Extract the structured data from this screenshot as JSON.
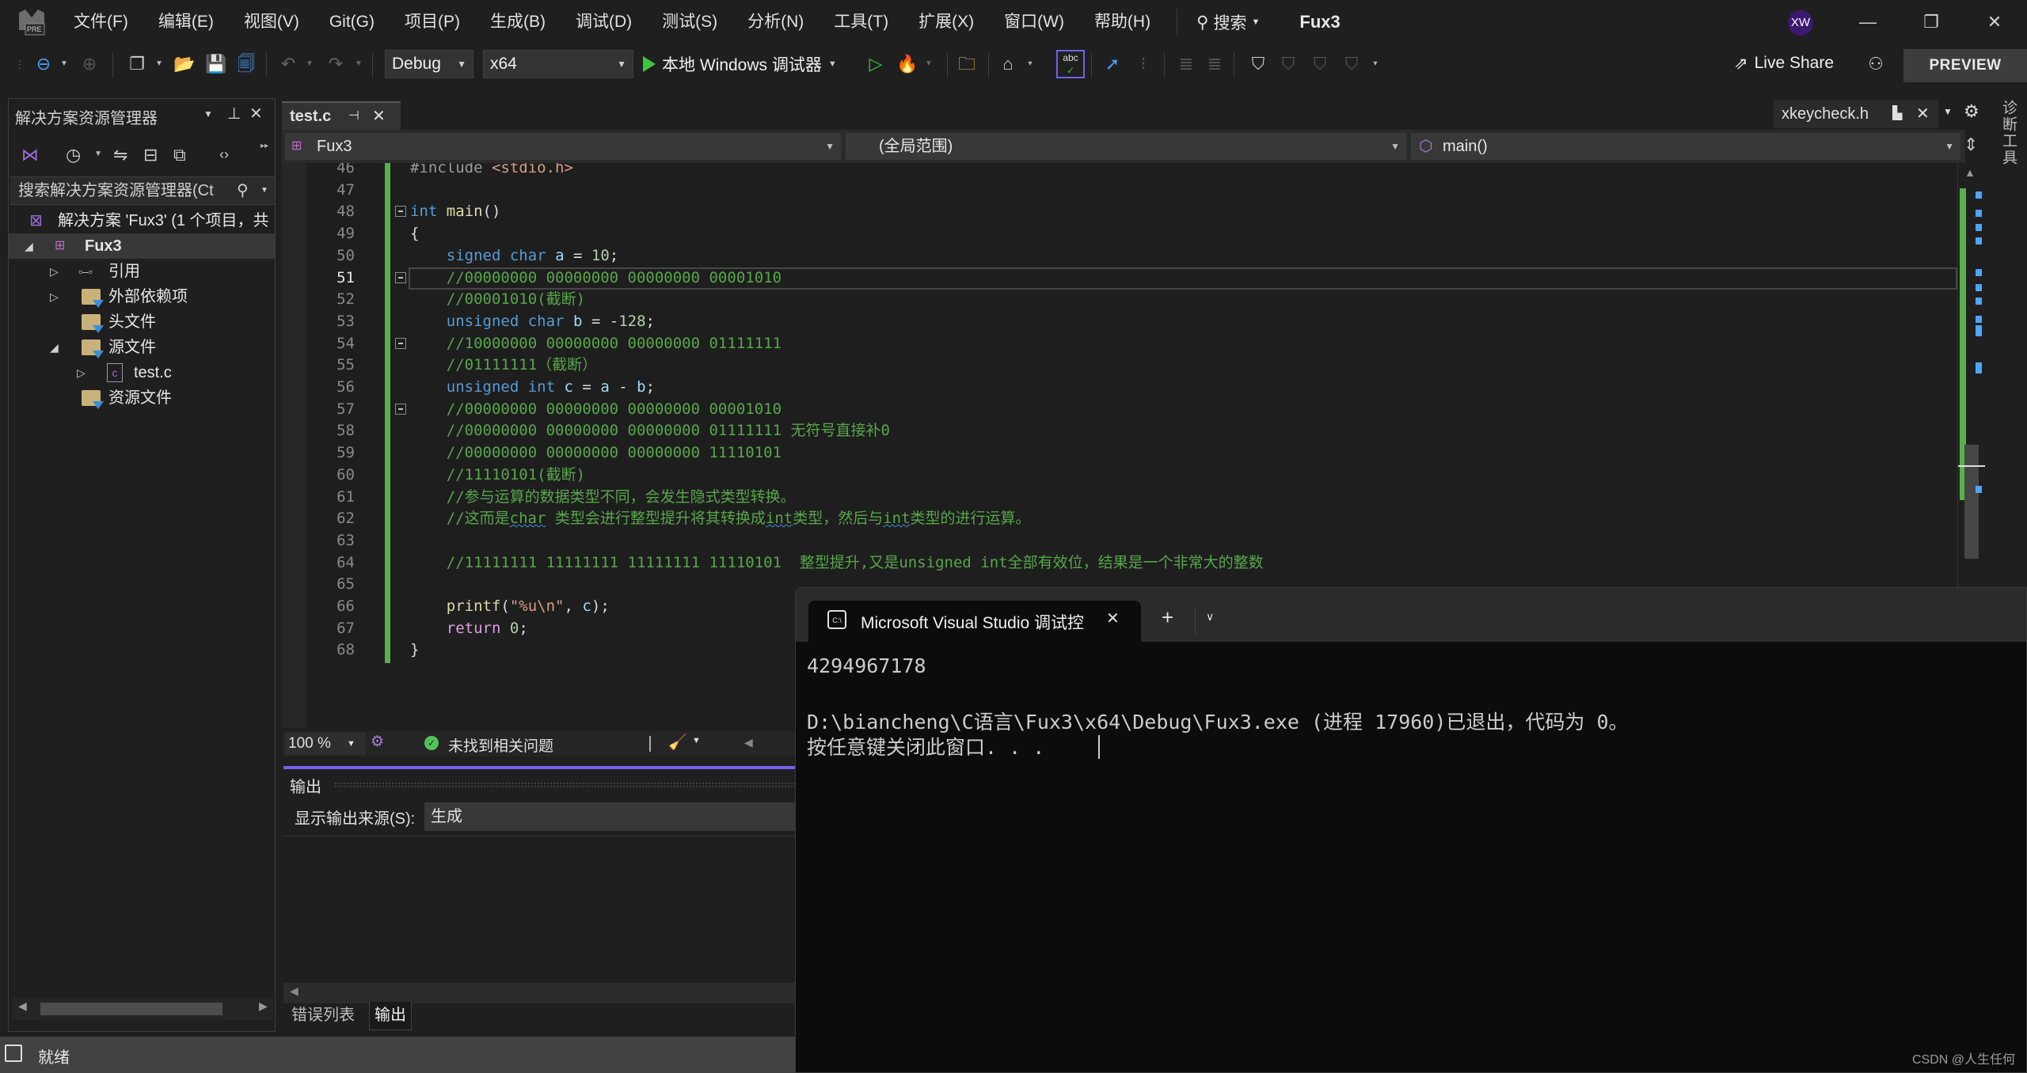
{
  "menubar": {
    "items": [
      "文件(F)",
      "编辑(E)",
      "视图(V)",
      "Git(G)",
      "项目(P)",
      "生成(B)",
      "调试(D)",
      "测试(S)",
      "分析(N)",
      "工具(T)",
      "扩展(X)",
      "窗口(W)",
      "帮助(H)"
    ],
    "search_label": "搜索",
    "project_title": "Fux3",
    "avatar_initials": "XW",
    "logo_badge": "PRE"
  },
  "toolbar": {
    "config": "Debug",
    "platform": "x64",
    "run_label": "本地 Windows 调试器",
    "live_share": "Live Share",
    "preview": "PREVIEW"
  },
  "solution_explorer": {
    "title": "解决方案资源管理器",
    "search_placeholder": "搜索解决方案资源管理器(Ct",
    "tree": [
      {
        "label": "解决方案 'Fux3' (1 个项目，共",
        "icon": "solution-icon",
        "level": 0
      },
      {
        "label": "Fux3",
        "icon": "cpp-project-icon",
        "level": 0,
        "expanded": true,
        "selected": true
      },
      {
        "label": "引用",
        "icon": "references-icon",
        "level": 1,
        "expanded": false
      },
      {
        "label": "外部依赖项",
        "icon": "external-deps-icon",
        "level": 1,
        "expanded": false
      },
      {
        "label": "头文件",
        "icon": "filter-folder-icon",
        "level": 1
      },
      {
        "label": "源文件",
        "icon": "filter-folder-icon",
        "level": 1,
        "expanded": true
      },
      {
        "label": "test.c",
        "icon": "c-file-icon",
        "level": 2,
        "expanded": false
      },
      {
        "label": "资源文件",
        "icon": "filter-folder-icon",
        "level": 1
      }
    ]
  },
  "editor": {
    "active_tab": "test.c",
    "other_tab": "xkeycheck.h",
    "nav_project": "Fux3",
    "nav_scope": "(全局范围)",
    "nav_member": "main()",
    "side_tool": "诊断工具",
    "current_line": 51,
    "lines": [
      {
        "n": 46,
        "text": "#include <stdio.h>"
      },
      {
        "n": 47,
        "text": ""
      },
      {
        "n": 48,
        "text": "int main()"
      },
      {
        "n": 49,
        "text": "{"
      },
      {
        "n": 50,
        "text": "    signed char a = 10;"
      },
      {
        "n": 51,
        "text": "    //00000000 00000000 00000000 00001010"
      },
      {
        "n": 52,
        "text": "    //00001010(截断)"
      },
      {
        "n": 53,
        "text": "    unsigned char b = -128;"
      },
      {
        "n": 54,
        "text": "    //10000000 00000000 00000000 01111111"
      },
      {
        "n": 55,
        "text": "    //01111111（截断）"
      },
      {
        "n": 56,
        "text": "    unsigned int c = a - b;"
      },
      {
        "n": 57,
        "text": "    //00000000 00000000 00000000 00001010"
      },
      {
        "n": 58,
        "text": "    //00000000 00000000 00000000 01111111 无符号直接补0"
      },
      {
        "n": 59,
        "text": "    //00000000 00000000 00000000 11110101"
      },
      {
        "n": 60,
        "text": "    //11110101(截断)"
      },
      {
        "n": 61,
        "text": "    //参与运算的数据类型不同，会发生隐式类型转换。"
      },
      {
        "n": 62,
        "text": "    //这而是char 类型会进行整型提升将其转换成int类型，然后与int类型的进行运算。"
      },
      {
        "n": 63,
        "text": ""
      },
      {
        "n": 64,
        "text": "    //11111111 11111111 11111111 11110101  整型提升,又是unsigned int全部有效位，结果是一个非常大的整数"
      },
      {
        "n": 65,
        "text": ""
      },
      {
        "n": 66,
        "text": "    printf(\"%u\\n\", c);"
      },
      {
        "n": 67,
        "text": "    return 0;"
      },
      {
        "n": 68,
        "text": "}"
      }
    ],
    "zoom": "100 %",
    "issues": "未找到相关问题"
  },
  "output_panel": {
    "title": "输出",
    "source_label": "显示输出来源(S):",
    "source_value": "生成",
    "tabs": [
      "错误列表",
      "输出"
    ],
    "active_tab": "输出"
  },
  "statusbar": {
    "text": "就绪"
  },
  "terminal": {
    "tab_title": "Microsoft Visual Studio 调试控",
    "lines": [
      "4294967178",
      "",
      "D:\\biancheng\\C语言\\Fux3\\x64\\Debug\\Fux3.exe (进程 17960)已退出，代码为 0。",
      "按任意键关闭此窗口. . ."
    ],
    "watermark": "CSDN @人生任何"
  },
  "colors": {
    "accent": "#7160e8",
    "keyword": "#569cd6",
    "comment": "#57a64a",
    "change_bar": "#57b04c",
    "avatar_bg": "#3c1870"
  }
}
